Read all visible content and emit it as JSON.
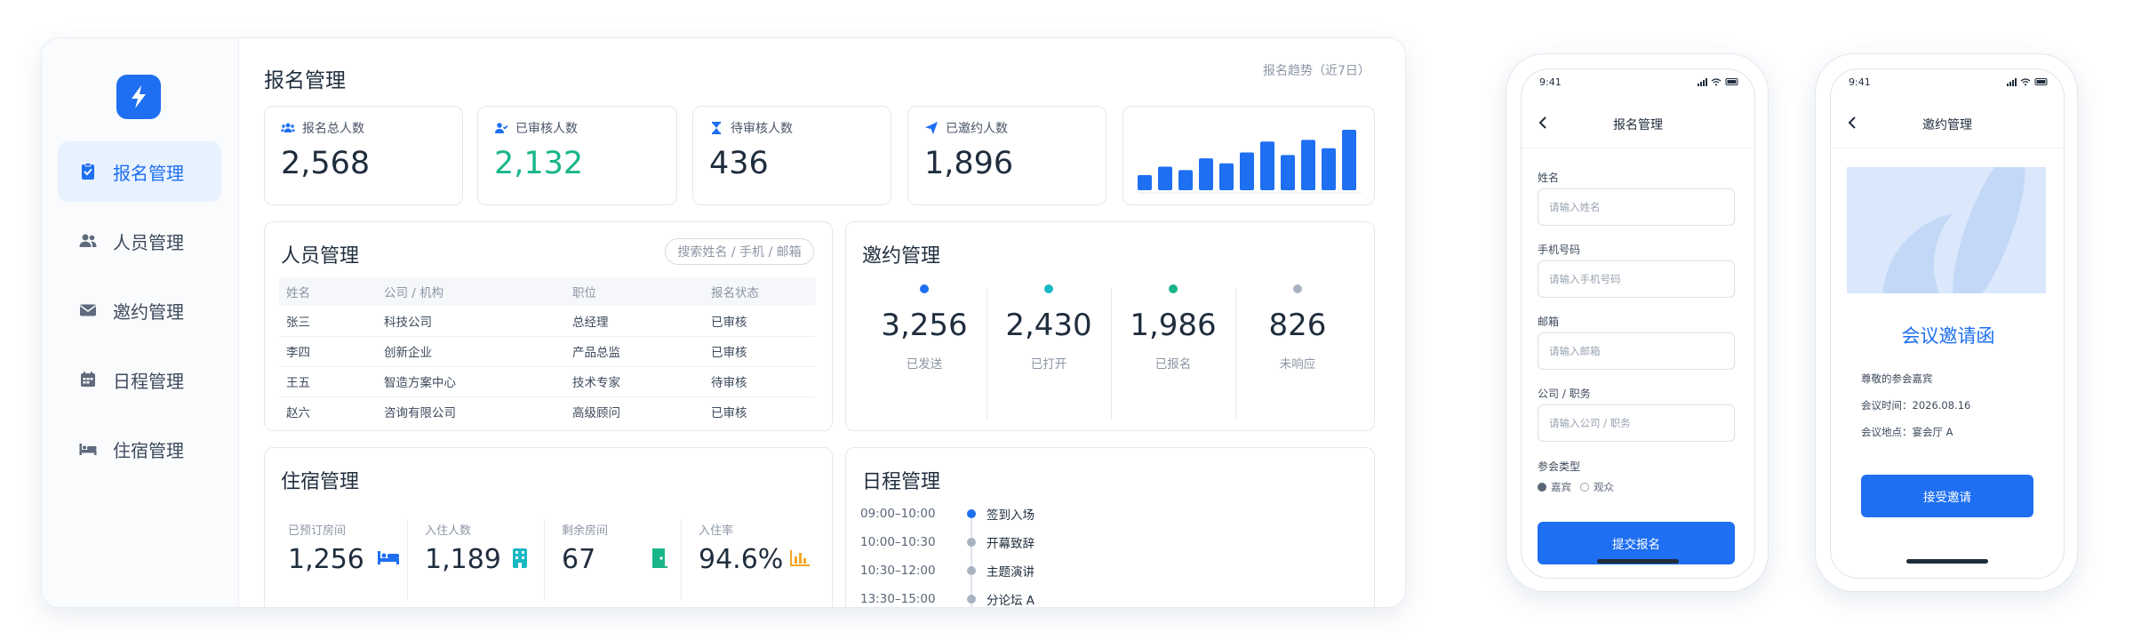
{
  "sidebar": {
    "items": [
      {
        "label": "报名管理",
        "icon": "clipboard-icon",
        "active": true
      },
      {
        "label": "人员管理",
        "icon": "people-icon",
        "active": false
      },
      {
        "label": "邀约管理",
        "icon": "envelope-icon",
        "active": false
      },
      {
        "label": "日程管理",
        "icon": "calendar-icon",
        "active": false
      },
      {
        "label": "住宿管理",
        "icon": "bed-icon",
        "active": false
      }
    ]
  },
  "header": {
    "title": "报名管理",
    "trend_label": "报名趋势（近7日）"
  },
  "stats": [
    {
      "label": "报名总人数",
      "value": "2,568",
      "icon": "group-icon"
    },
    {
      "label": "已审核人数",
      "value": "2,132",
      "icon": "user-check-icon"
    },
    {
      "label": "待审核人数",
      "value": "436",
      "icon": "hourglass-icon"
    },
    {
      "label": "已邀约人数",
      "value": "1,896",
      "icon": "send-icon"
    }
  ],
  "trend_chart": {
    "type": "bar",
    "values": [
      18,
      28,
      24,
      38,
      32,
      45,
      58,
      42,
      60,
      50,
      72
    ]
  },
  "people": {
    "title": "人员管理",
    "search_placeholder": "搜索姓名 / 手机 / 邮箱",
    "columns": [
      "姓名",
      "公司 / 机构",
      "职位",
      "报名状态"
    ],
    "rows": [
      {
        "name": "张三",
        "company": "科技公司",
        "position": "总经理",
        "status": "已审核"
      },
      {
        "name": "李四",
        "company": "创新企业",
        "position": "产品总监",
        "status": "已审核"
      },
      {
        "name": "王五",
        "company": "智造方案中心",
        "position": "技术专家",
        "status": "待审核"
      },
      {
        "name": "赵六",
        "company": "咨询有限公司",
        "position": "高级顾问",
        "status": "已审核"
      }
    ]
  },
  "invitations": {
    "title": "邀约管理",
    "items": [
      {
        "value": "3,256",
        "label": "已发送",
        "color": "#1e6ff1"
      },
      {
        "value": "2,430",
        "label": "已打开",
        "color": "#19b8c4"
      },
      {
        "value": "1,986",
        "label": "已报名",
        "color": "#19b58a"
      },
      {
        "value": "826",
        "label": "未响应",
        "color": "#a9b3c2"
      }
    ]
  },
  "accommodation": {
    "title": "住宿管理",
    "items": [
      {
        "label": "已预订房间",
        "value": "1,256",
        "icon": "bed-icon",
        "color": "#1e6ff1"
      },
      {
        "label": "入住人数",
        "value": "1,189",
        "icon": "building-icon",
        "color": "#19b8c4"
      },
      {
        "label": "剩余房间",
        "value": "67",
        "icon": "door-icon",
        "color": "#19b58a"
      },
      {
        "label": "入住率",
        "value": "94.6%",
        "icon": "bar-chart-icon",
        "color": "#f5a623"
      }
    ]
  },
  "schedule": {
    "title": "日程管理",
    "items": [
      {
        "time": "09:00–10:00",
        "label": "签到入场",
        "color": "#1e6ff1"
      },
      {
        "time": "10:00–10:30",
        "label": "开幕致辞",
        "color": "#a9b3c2"
      },
      {
        "time": "10:30–12:00",
        "label": "主题演讲",
        "color": "#a9b3c2"
      },
      {
        "time": "13:30–15:00",
        "label": "分论坛 A",
        "color": "#a9b3c2"
      }
    ]
  },
  "phone_form": {
    "time": "9:41",
    "title": "报名管理",
    "fields": [
      {
        "label": "姓名",
        "placeholder": "请输入姓名"
      },
      {
        "label": "手机号码",
        "placeholder": "请输入手机号码"
      },
      {
        "label": "邮箱",
        "placeholder": "请输入邮箱"
      },
      {
        "label": "公司 / 职务",
        "placeholder": "请输入公司 / 职务"
      }
    ],
    "type_label": "参会类型",
    "type_options": [
      "嘉宾",
      "观众"
    ],
    "submit_label": "提交报名"
  },
  "phone_invite": {
    "time": "9:41",
    "title": "邀约管理",
    "heading": "会议邀请函",
    "greeting": "尊敬的参会嘉宾",
    "date_line": "会议时间：2026.08.16",
    "place_line": "会议地点：宴会厅 A",
    "accept_label": "接受邀请"
  },
  "colors": {
    "accent": "#1e6ff1",
    "green": "#19b58a",
    "teal": "#19b8c4",
    "orange": "#f5a623",
    "gray": "#a9b3c2"
  }
}
